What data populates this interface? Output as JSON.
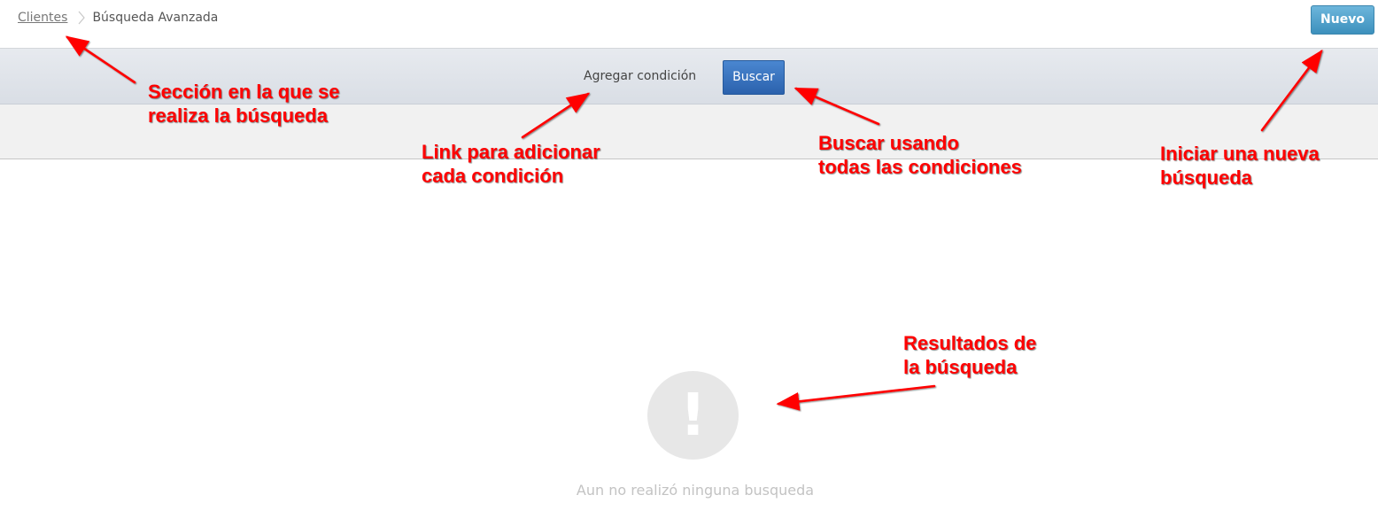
{
  "header": {
    "breadcrumb": {
      "link": "Clientes",
      "current": "Búsqueda Avanzada"
    },
    "new_button": "Nuevo"
  },
  "toolbar": {
    "add_condition": "Agregar condición",
    "search_button": "Buscar"
  },
  "results": {
    "empty_icon": "!",
    "empty_message": "Aun no realizó ninguna busqueda"
  },
  "annotations": {
    "section": "Sección en la que se\nrealiza la búsqueda",
    "add_link": "Link para adicionar\ncada condición",
    "search": "Buscar usando\ntodas las condiciones",
    "new": "Iniciar una nueva\nbúsqueda",
    "results": "Resultados de\nla búsqueda"
  },
  "colors": {
    "annotation": "#ff0000",
    "search_button": "#2f6bb4",
    "new_button": "#4a9ccb"
  }
}
